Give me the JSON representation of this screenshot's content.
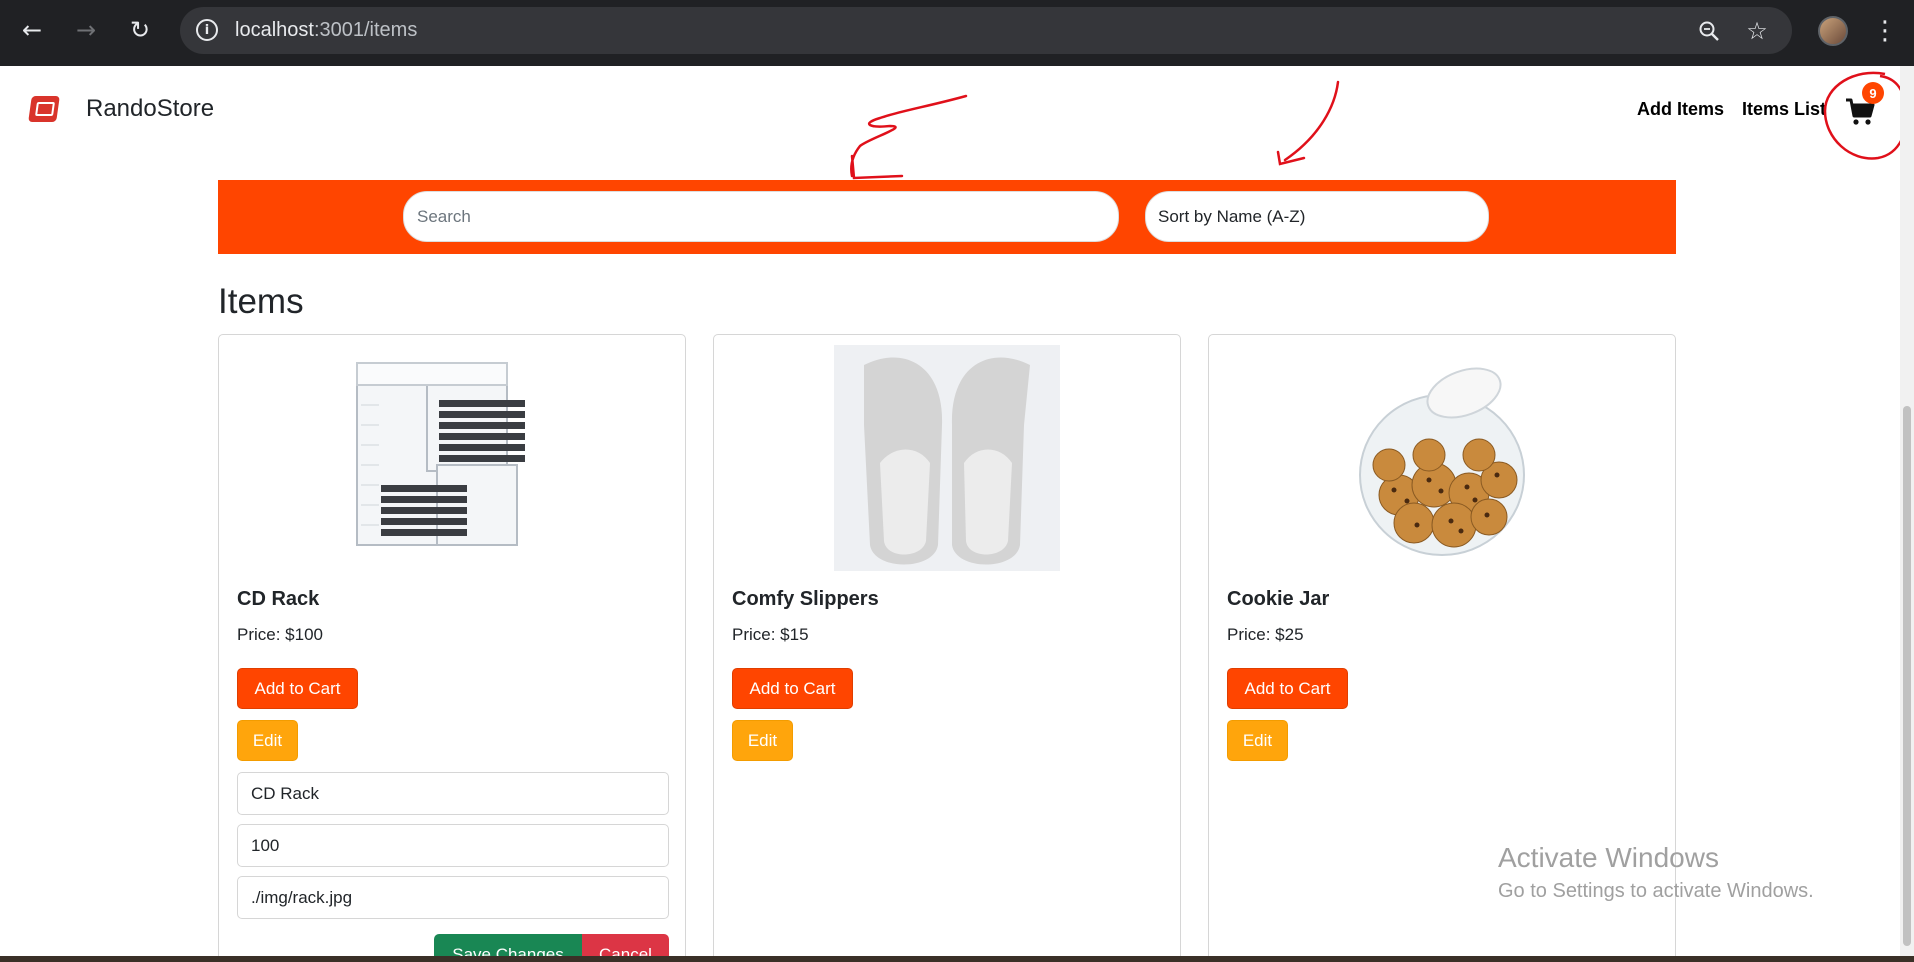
{
  "browser": {
    "url_host": "localhost",
    "url_rest": ":3001/items",
    "icons": [
      "back-arrow-icon",
      "forward-arrow-icon",
      "reload-icon",
      "info-icon",
      "zoom-icon",
      "star-icon",
      "profile-avatar",
      "kebab-menu-icon"
    ]
  },
  "navbar": {
    "brand": "RandoStore",
    "logo_text": "rando",
    "links": [
      "Add Items",
      "Items List"
    ],
    "cart_count": "9"
  },
  "filters": {
    "search_placeholder": "Search",
    "sort_value": "Sort by Name (A-Z)"
  },
  "page_title": "Items",
  "items": [
    {
      "name": "CD Rack",
      "price": "Price: $100",
      "add_label": "Add to Cart",
      "edit_label": "Edit",
      "editing": true,
      "edit_fields": [
        "CD Rack",
        "100",
        "./img/rack.jpg"
      ],
      "save_label": "Save Changes",
      "cancel_label": "Cancel"
    },
    {
      "name": "Comfy Slippers",
      "price": "Price: $15",
      "add_label": "Add to Cart",
      "edit_label": "Edit"
    },
    {
      "name": "Cookie Jar",
      "price": "Price: $25",
      "add_label": "Add to Cart",
      "edit_label": "Edit"
    }
  ],
  "watermark": {
    "line1": "Activate Windows",
    "line2": "Go to Settings to activate Windows."
  },
  "colors": {
    "accent": "#ff4500",
    "edit": "#ffa50c",
    "save": "#198754",
    "cancel": "#dc3545",
    "annotation": "#e0101a"
  }
}
